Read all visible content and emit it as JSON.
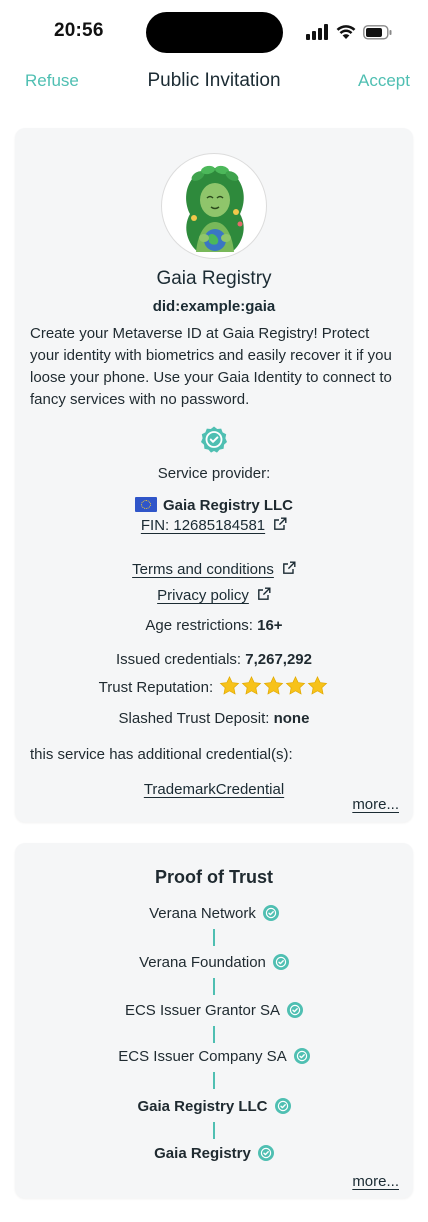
{
  "status_bar": {
    "time": "20:56"
  },
  "nav": {
    "refuse": "Refuse",
    "title": "Public Invitation",
    "accept": "Accept"
  },
  "colors": {
    "accent": "#4fbfb2",
    "card_bg": "#f5f6f7",
    "star": "#f7c21a"
  },
  "service": {
    "name": "Gaia Registry",
    "did": "did:example:gaia",
    "description": "Create your Metaverse ID at Gaia Registry! Protect your identity with biometrics and easily recover it if you loose your phone. Use your Gaia Identity to connect to fancy services with no password.",
    "provider_label": "Service provider:",
    "provider_name": "Gaia Registry LLC",
    "provider_flag": "eu-flag-icon",
    "fin": "FIN: 12685184581",
    "terms": "Terms and conditions",
    "privacy": "Privacy policy",
    "age_label": "Age restrictions: ",
    "age_value": "16+",
    "issued_label": "Issued credentials: ",
    "issued_value": "7,267,292",
    "trust_label": "Trust Reputation:",
    "trust_stars": 5,
    "slashed_label": "Slashed Trust Deposit: ",
    "slashed_value": "none",
    "additional_label": "this service has additional credential(s):",
    "additional_credentials": [
      "TrademarkCredential"
    ],
    "more": "more..."
  },
  "proof": {
    "title": "Proof of Trust",
    "chain": [
      {
        "label": "Verana Network",
        "bold": false
      },
      {
        "label": "Verana Foundation",
        "bold": false
      },
      {
        "label": "ECS Issuer Grantor SA",
        "bold": false
      },
      {
        "label": "ECS Issuer Company SA",
        "bold": false
      },
      {
        "label": "Gaia Registry LLC",
        "bold": true
      },
      {
        "label": "Gaia Registry",
        "bold": true
      }
    ],
    "more": "more..."
  }
}
